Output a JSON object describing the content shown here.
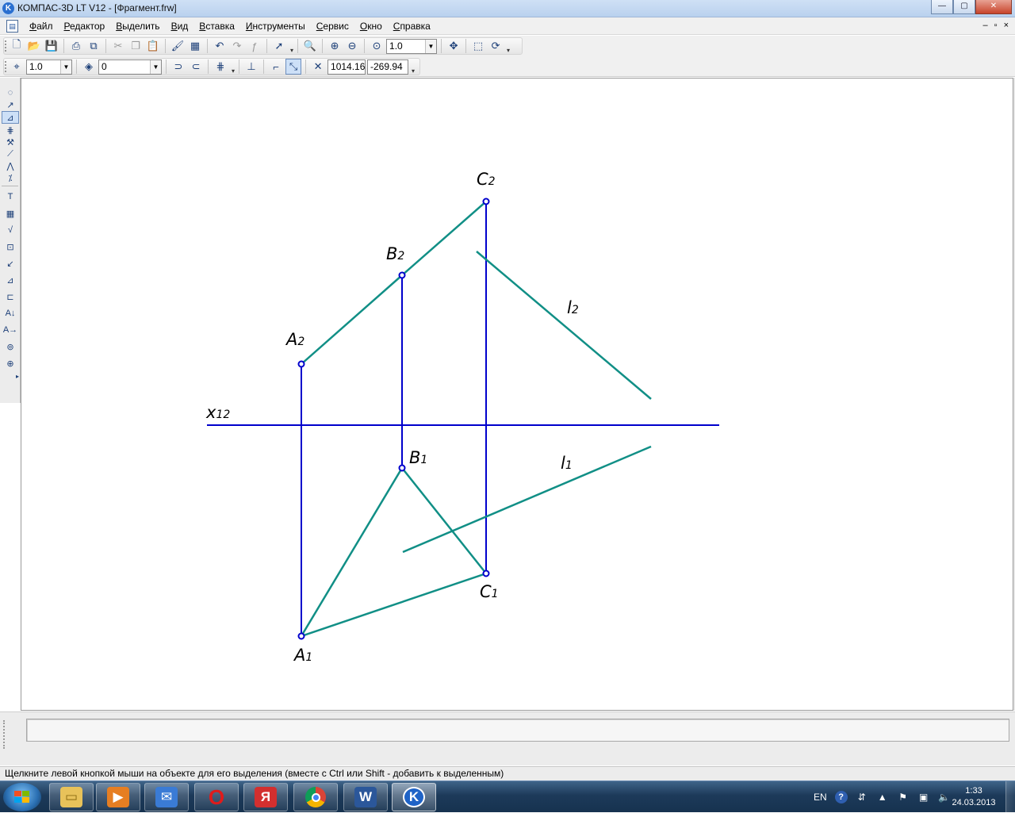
{
  "window": {
    "app_icon": "kompas-icon",
    "title": "КОМПАС-3D LT V12 - [Фрагмент.frw]",
    "buttons": {
      "minimize": "—",
      "maximize": "▢",
      "close": "✕"
    }
  },
  "menu": {
    "items": [
      "Файл",
      "Редактор",
      "Выделить",
      "Вид",
      "Вставка",
      "Инструменты",
      "Сервис",
      "Окно",
      "Справка"
    ],
    "doc_controls": {
      "minimize": "–",
      "restore": "▫",
      "close": "×"
    }
  },
  "toolbar1": {
    "zoom_value": "1.0"
  },
  "toolbar2": {
    "step_value": "1.0",
    "layer_value": "0",
    "coord_x": "1014.16",
    "coord_y": "-269.94"
  },
  "drawing": {
    "labels": {
      "a2": {
        "main": "A",
        "sub": "2"
      },
      "b2": {
        "main": "B",
        "sub": "2"
      },
      "c2": {
        "main": "C",
        "sub": "2"
      },
      "l2": {
        "main": "l",
        "sub": "2"
      },
      "x12": {
        "main": "x",
        "sub": "12"
      },
      "a1": {
        "main": "A",
        "sub": "1"
      },
      "b1": {
        "main": "B",
        "sub": "1"
      },
      "c1": {
        "main": "C",
        "sub": "1"
      },
      "l1": {
        "main": "l",
        "sub": "1"
      }
    },
    "colors": {
      "main_line": "#0000cc",
      "aux_line": "#118f86"
    }
  },
  "status": {
    "hint": "Щелкните левой кнопкой мыши на объекте для его выделения (вместе с Ctrl или Shift - добавить к выделенным)"
  },
  "taskbar": {
    "apps": [
      "explorer-icon",
      "media-player-icon",
      "mail-icon",
      "opera-icon",
      "yandex-icon",
      "chrome-icon",
      "word-icon",
      "kompas-icon"
    ],
    "lang": "EN",
    "time": "1:33",
    "date": "24.03.2013"
  }
}
